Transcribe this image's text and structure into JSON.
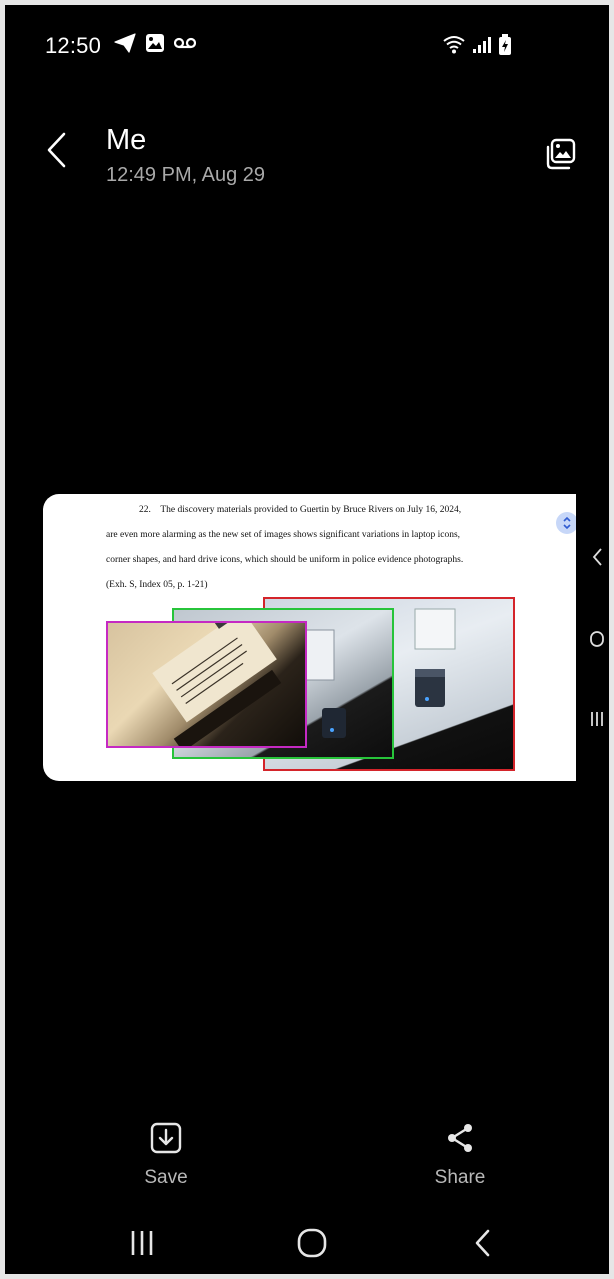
{
  "status_bar": {
    "time": "12:50",
    "left_icons": [
      "telegram-icon",
      "image-icon",
      "voicemail-icon"
    ],
    "right_icons": [
      "wifi-calling-icon",
      "signal-icon",
      "battery-charging-icon"
    ]
  },
  "header": {
    "title": "Me",
    "subtitle": "12:49 PM, Aug 29"
  },
  "image": {
    "paragraph": {
      "line1": "22. The discovery materials provided to Guertin by Bruce Rivers on July 16, 2024,",
      "line2": "are even more alarming as the new set of images shows significant variations in laptop icons,",
      "line3": "corner shapes, and hard drive icons, which should be uniform in police evidence photographs.",
      "line4": "(Exh. S, Index 05, p. 1-21)"
    },
    "photo_frame_colors": [
      "#d4242a",
      "#27c43a",
      "#c529c3"
    ]
  },
  "actions": {
    "save_label": "Save",
    "share_label": "Share"
  },
  "colors": {
    "background": "#000000",
    "subtitle": "#a9a9a9",
    "action_label": "#b8b8b8"
  }
}
